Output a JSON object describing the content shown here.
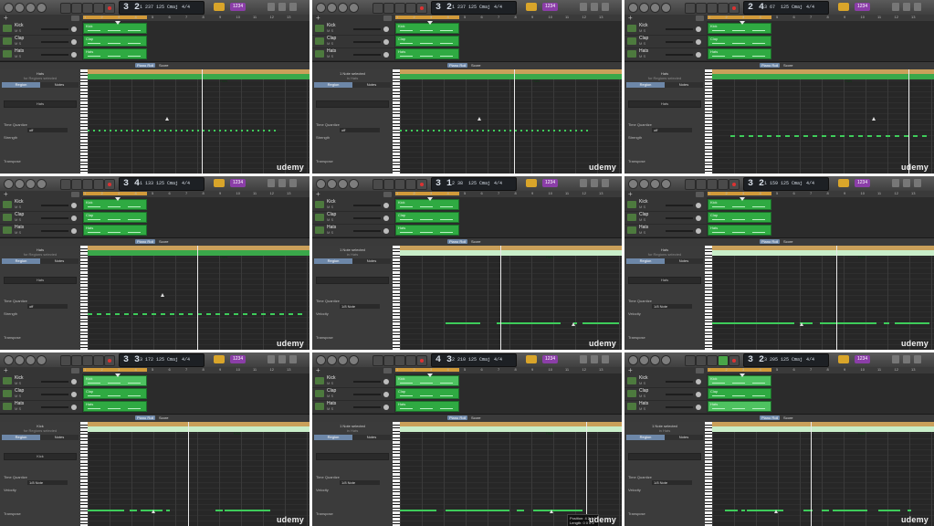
{
  "watermark": "udemy",
  "colors": {
    "region": "#2faa42",
    "note": "#3ecc5a",
    "accent": "#6d87a8"
  },
  "tracks": [
    {
      "name": "Kick",
      "ms": "M S"
    },
    {
      "name": "Clap",
      "ms": "M S"
    },
    {
      "name": "Hats",
      "ms": "M S"
    }
  ],
  "editor_tabs": [
    "Piano Roll",
    "Score"
  ],
  "inspector": {
    "tab_region": "Region",
    "tab_notes": "Notes",
    "time_quantize": "Time Quantize",
    "strength": "Strength",
    "transpose": "Transpose",
    "velocity": "Velocity",
    "off": "off",
    "eighth": "1/8 Note",
    "quantize_btn": "Q",
    "hats_sub": "for Regions selected",
    "note_sel": "1 Note selected",
    "note_sel_sub": "in Hats"
  },
  "panels": [
    {
      "pos": "3 2",
      "sub": "1 237",
      "tempo": "125",
      "key": "Cmaj",
      "sig": "4/4",
      "count": "1234",
      "header": "Hats",
      "bar": "Hats",
      "inspector_name": "Hats",
      "light": false
    },
    {
      "pos": "3 2",
      "sub": "1 237",
      "tempo": "125",
      "key": "Cmaj",
      "sig": "4/4",
      "count": "1234",
      "header": "1 Note selected",
      "bar": "Hats",
      "inspector_name": "",
      "light": false
    },
    {
      "pos": "2 4",
      "sub": "3 67",
      "tempo": "125",
      "key": "Cmaj",
      "sig": "4/4",
      "count": "1234",
      "header": "Hats",
      "bar": "Hats",
      "inspector_name": "Hats",
      "light": false
    },
    {
      "pos": "3 4",
      "sub": "1 133",
      "tempo": "125",
      "key": "Cmaj",
      "sig": "4/4",
      "count": "1234",
      "header": "Hats",
      "bar": "Hats",
      "inspector_name": "Hats",
      "light": false
    },
    {
      "pos": "3 1",
      "sub": "2 38",
      "tempo": "125",
      "key": "Cmaj",
      "sig": "4/4",
      "count": "1234",
      "header": "1 Note selected",
      "bar": "Hats",
      "inspector_name": "",
      "light": true
    },
    {
      "pos": "3 2",
      "sub": "1 159",
      "tempo": "125",
      "key": "Cmaj",
      "sig": "4/4",
      "count": "1234",
      "header": "Hats",
      "bar": "Hats",
      "inspector_name": "Hats",
      "light": true
    },
    {
      "pos": "3 3",
      "sub": "3 172",
      "tempo": "125",
      "key": "Cmaj",
      "sig": "4/4",
      "count": "1234",
      "header": "Kick",
      "bar": "Kick",
      "inspector_name": "Kick",
      "light": true
    },
    {
      "pos": "4 3",
      "sub": "2 210",
      "tempo": "125",
      "key": "Cmaj",
      "sig": "4/4",
      "count": "1234",
      "header": "1 Note selected",
      "bar": "Hats",
      "inspector_name": "",
      "light": true
    },
    {
      "pos": "3 2",
      "sub": "3 205",
      "tempo": "125",
      "key": "Cmaj",
      "sig": "4/4",
      "count": "1234",
      "header": "1 Note selected",
      "bar": "Hats",
      "inspector_name": "",
      "light": true
    }
  ],
  "tooltip": {
    "position": "Position: 4 2 4 1",
    "length": "Length: 0 0 0 2"
  }
}
